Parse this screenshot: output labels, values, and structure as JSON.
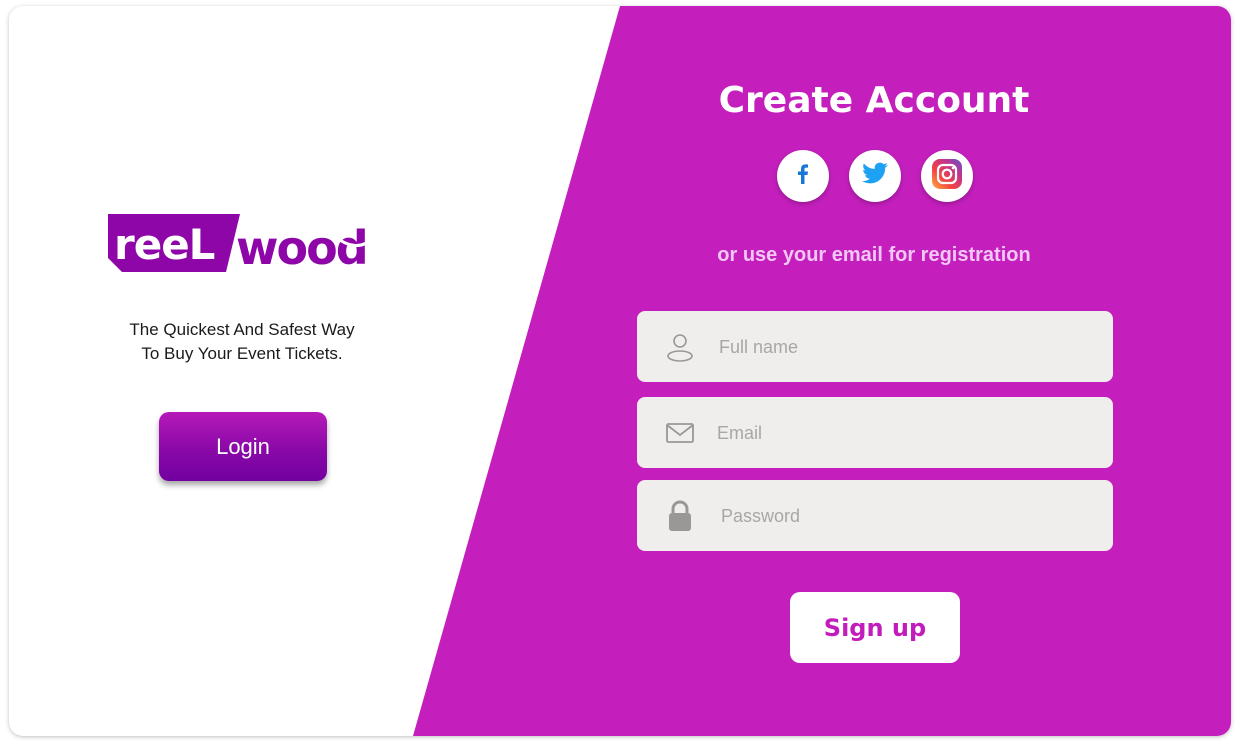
{
  "brand": {
    "logo_text": "reelwood",
    "tagline_line1": "The Quickest And Safest Way",
    "tagline_line2": "To Buy Your Event Tickets."
  },
  "left_panel": {
    "login_label": "Login"
  },
  "signup_panel": {
    "title": "Create Account",
    "social": [
      {
        "name": "facebook-icon"
      },
      {
        "name": "twitter-icon"
      },
      {
        "name": "instagram-icon"
      }
    ],
    "subtitle": "or use your email for registration",
    "fields": {
      "fullname_placeholder": "Full name",
      "email_placeholder": "Email",
      "password_placeholder": "Password"
    },
    "signup_label": "Sign up"
  },
  "colors": {
    "accent": "#c41fbd",
    "button_gradient_top": "#b51ab8",
    "button_gradient_bottom": "#7200a0",
    "field_bg": "#f0eeec",
    "subtitle": "#f2c6f5"
  }
}
